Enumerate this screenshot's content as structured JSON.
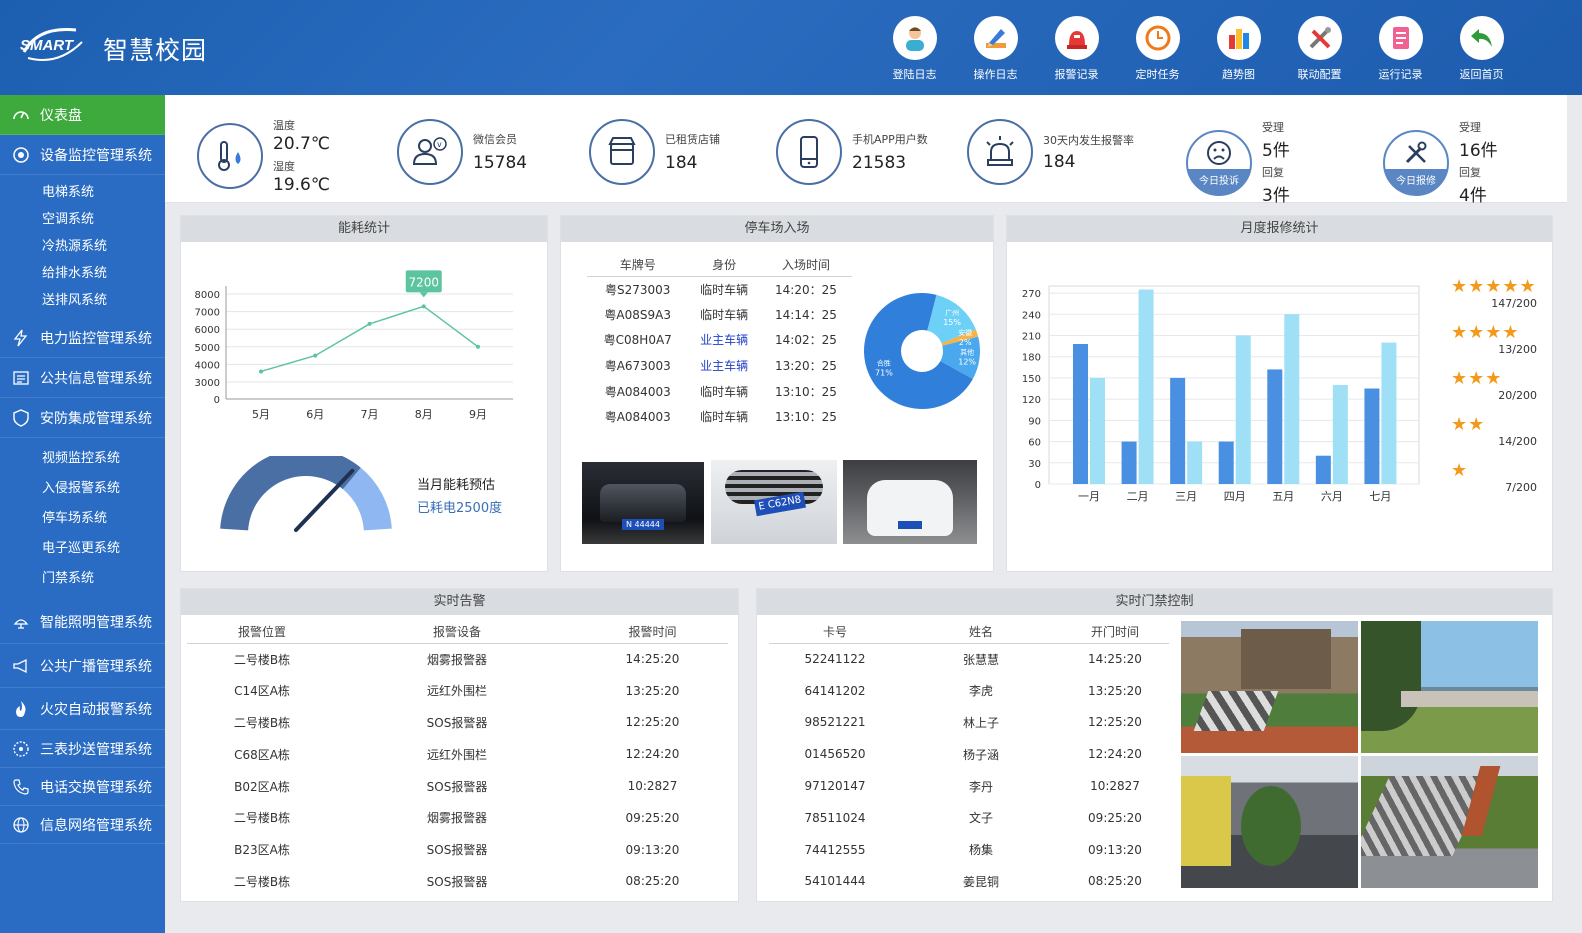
{
  "app": {
    "logo_text": "SMART",
    "title": "智慧校园"
  },
  "topnav": [
    {
      "label": "登陆日志",
      "icon": "user-login-icon"
    },
    {
      "label": "操作日志",
      "icon": "pencil-icon"
    },
    {
      "label": "报警记录",
      "icon": "alarm-siren-icon"
    },
    {
      "label": "定时任务",
      "icon": "clock-icon"
    },
    {
      "label": "趋势图",
      "icon": "bar-chart-icon"
    },
    {
      "label": "联动配置",
      "icon": "tools-icon"
    },
    {
      "label": "运行记录",
      "icon": "document-icon"
    },
    {
      "label": "返回首页",
      "icon": "return-arrow-icon"
    }
  ],
  "sidebar": {
    "dashboard": "仪表盘",
    "device": {
      "label": "设备监控管理系统",
      "subs": [
        "电梯系统",
        "空调系统",
        "冷热源系统",
        "给排水系统",
        "送排风系统"
      ]
    },
    "power": "电力监控管理系统",
    "info": "公共信息管理系统",
    "security": {
      "label": "安防集成管理系统",
      "subs": [
        "视频监控系统",
        "入侵报警系统",
        "停车场系统",
        "电子巡更系统",
        "门禁系统"
      ]
    },
    "lighting": "智能照明管理系统",
    "broadcast": "公共广播管理系统",
    "fire": "火灾自动报警系统",
    "meter": "三表抄送管理系统",
    "phone": "电话交换管理系统",
    "network": "信息网络管理系统"
  },
  "stats": {
    "temp_label": "温度",
    "temp_value": "20.7℃",
    "hum_label": "湿度",
    "hum_value": "19.6℃",
    "wechat_label": "微信会员",
    "wechat_value": "15784",
    "shops_label": "已租赁店铺",
    "shops_value": "184",
    "app_label": "手机APP用户数",
    "app_value": "21583",
    "alarm_label": "30天内发生报警率",
    "alarm_value": "184",
    "complaint": {
      "cap": "今日投诉",
      "accept_label": "受理",
      "accept_value": "5件",
      "reply_label": "回复",
      "reply_value": "3件"
    },
    "repair": {
      "cap": "今日报修",
      "accept_label": "受理",
      "accept_value": "16件",
      "reply_label": "回复",
      "reply_value": "4件"
    }
  },
  "energy": {
    "title": "能耗统计",
    "gauge_title": "当月能耗预估",
    "gauge_sub": "已耗电2500度"
  },
  "parking": {
    "title": "停车场入场",
    "headers": [
      "车牌号",
      "身份",
      "入场时间"
    ],
    "rows": [
      [
        "粤S273003",
        "临时车辆",
        "14:20：25"
      ],
      [
        "粤A08S9A3",
        "临时车辆",
        "14:14：25"
      ],
      [
        "粤C08H0A7",
        "业主车辆",
        "14:02：25"
      ],
      [
        "粤A673003",
        "业主车辆",
        "13:20：25"
      ],
      [
        "粤A084003",
        "临时车辆",
        "13:10：25"
      ],
      [
        "粤A084003",
        "临时车辆",
        "13:10：25"
      ]
    ],
    "plates": [
      "N 44444",
      "E C62N8",
      ""
    ]
  },
  "repair": {
    "title": "月度报修统计",
    "ratings": [
      {
        "stars": 5,
        "text": "147/200"
      },
      {
        "stars": 4,
        "text": "13/200"
      },
      {
        "stars": 3,
        "text": "20/200"
      },
      {
        "stars": 2,
        "text": "14/200"
      },
      {
        "stars": 1,
        "text": "7/200"
      }
    ]
  },
  "alarms": {
    "title": "实时告警",
    "headers": [
      "报警位置",
      "报警设备",
      "报警时间"
    ],
    "rows": [
      [
        "二号楼B栋",
        "烟雾报警器",
        "14:25:20"
      ],
      [
        "C14区A栋",
        "远红外围栏",
        "13:25:20"
      ],
      [
        "二号楼B栋",
        "SOS报警器",
        "12:25:20"
      ],
      [
        "C68区A栋",
        "远红外围栏",
        "12:24:20"
      ],
      [
        "B02区A栋",
        "SOS报警器",
        "10:2827"
      ],
      [
        "二号楼B栋",
        "烟雾报警器",
        "09:25:20"
      ],
      [
        "B23区A栋",
        "SOS报警器",
        "09:13:20"
      ],
      [
        "二号楼B栋",
        "SOS报警器",
        "08:25:20"
      ]
    ]
  },
  "access": {
    "title": "实时门禁控制",
    "headers": [
      "卡号",
      "姓名",
      "开门时间"
    ],
    "rows": [
      [
        "52241122",
        "张慧慧",
        "14:25:20"
      ],
      [
        "64141202",
        "李虎",
        "13:25:20"
      ],
      [
        "98521221",
        "林上子",
        "12:25:20"
      ],
      [
        "01456520",
        "杨子涵",
        "12:24:20"
      ],
      [
        "97120147",
        "李丹",
        "10:2827"
      ],
      [
        "78511024",
        "文子",
        "09:25:20"
      ],
      [
        "74412555",
        "杨集",
        "09:13:20"
      ],
      [
        "54101444",
        "姜昆铜",
        "08:25:20"
      ]
    ]
  },
  "chart_data": [
    {
      "type": "line",
      "title": "能耗统计",
      "categories": [
        "5月",
        "6月",
        "7月",
        "8月",
        "9月"
      ],
      "values": [
        3600,
        4500,
        6300,
        7300,
        5000
      ],
      "highlight_label": "7200",
      "ylim": [
        0,
        8000
      ],
      "yticks": [
        0,
        3000,
        4000,
        5000,
        6000,
        7000,
        8000
      ],
      "grid": true,
      "color": "#5cc5a0"
    },
    {
      "type": "pie",
      "title": "停车场入场",
      "slices": [
        {
          "name": "合胜",
          "value": 71,
          "label": "71%",
          "color": "#2f7fdb"
        },
        {
          "name": "广州",
          "value": 15,
          "label": "15%",
          "color": "#6dd0f7"
        },
        {
          "name": "安徽",
          "value": 2,
          "label": "2%",
          "color": "#f5b44a"
        },
        {
          "name": "其他",
          "value": 12,
          "label": "12%",
          "color": "#4aa8ee"
        }
      ]
    },
    {
      "type": "bar",
      "title": "月度报修统计",
      "categories": [
        "一月",
        "二月",
        "三月",
        "四月",
        "五月",
        "六月",
        "七月"
      ],
      "series": [
        {
          "values": [
            198,
            60,
            150,
            60,
            162,
            40,
            135
          ],
          "color": "#4a90e2"
        },
        {
          "values": [
            150,
            275,
            60,
            210,
            240,
            140,
            200
          ],
          "color": "#9fe0f7"
        }
      ],
      "ylim": [
        0,
        280
      ],
      "yticks": [
        0,
        30,
        60,
        90,
        120,
        150,
        180,
        210,
        240,
        270
      ],
      "grid": true
    },
    {
      "type": "gauge",
      "title": "当月能耗预估",
      "value": 0.72,
      "colors": [
        "#4a6fa5",
        "#8fb8f2"
      ]
    }
  ]
}
